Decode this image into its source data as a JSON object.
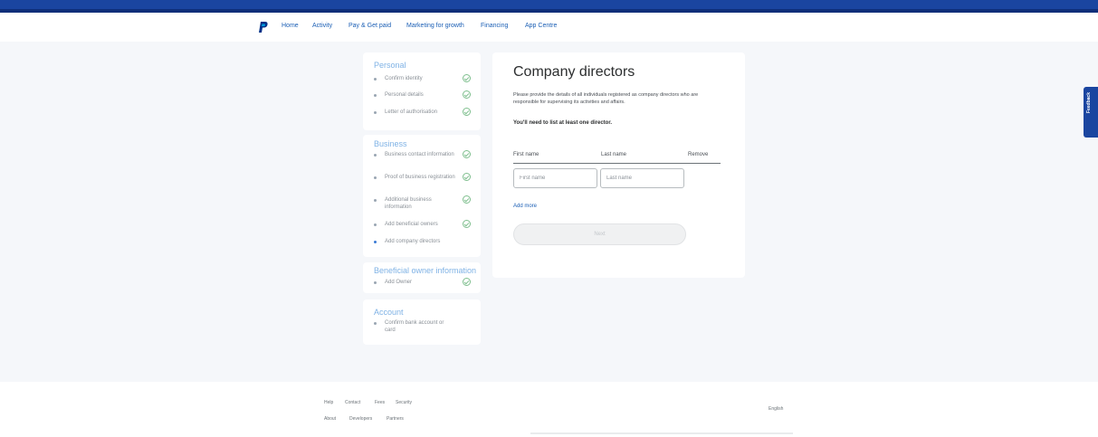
{
  "nav": {
    "items": [
      "Home",
      "Activity",
      "Pay & Get paid",
      "Marketing for growth",
      "Financing",
      "App Centre"
    ]
  },
  "sidebar": {
    "sections": [
      {
        "title": "Personal",
        "items": [
          {
            "label": "Confirm identity",
            "done": true
          },
          {
            "label": "Personal details",
            "done": true
          },
          {
            "label": "Letter of authorisation",
            "done": true
          }
        ]
      },
      {
        "title": "Business",
        "items": [
          {
            "label": "Business contact information",
            "done": true
          },
          {
            "label": "Proof of business registration",
            "done": true
          },
          {
            "label": "Additional business information",
            "done": true
          },
          {
            "label": "Add beneficial owners",
            "done": true
          },
          {
            "label": "Add company directors",
            "done": false,
            "active": true
          }
        ]
      },
      {
        "title": "Beneficial owner information",
        "items": [
          {
            "label": "Add Owner",
            "done": true
          }
        ]
      },
      {
        "title": "Account",
        "items": [
          {
            "label": "Confirm bank account or card",
            "done": false
          }
        ]
      }
    ]
  },
  "form": {
    "title": "Company directors",
    "description": "Please provide the details of all individuals registered as company directors who are responsible for supervising its activities and affairs.",
    "note": "You'll need to list at least one director.",
    "columns": {
      "first": "First name",
      "last": "Last name",
      "remove": "Remove"
    },
    "first_placeholder": "First name",
    "last_placeholder": "Last name",
    "add_more": "Add more",
    "next": "Next"
  },
  "feedback_label": "Feedback",
  "footer": {
    "row1": [
      "Help",
      "Contact",
      "Fees",
      "Security"
    ],
    "row2": [
      "About",
      "Developers",
      "Partners"
    ],
    "language": "English"
  },
  "colors": {
    "brand_bar": "#1a45a0",
    "link": "#1b5fb5",
    "section_title": "#7fb2e5",
    "check": "#7fbf8e",
    "page_bg": "#f5f7fa"
  }
}
